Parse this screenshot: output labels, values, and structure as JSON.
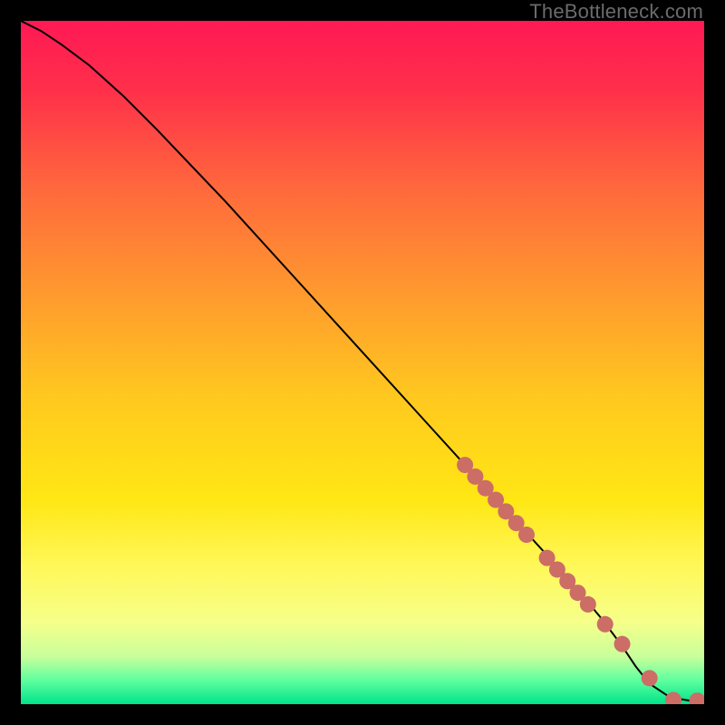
{
  "watermark": "TheBottleneck.com",
  "chart_data": {
    "type": "line",
    "title": "",
    "xlabel": "",
    "ylabel": "",
    "xlim": [
      0,
      100
    ],
    "ylim": [
      0,
      100
    ],
    "grid": false,
    "legend": false,
    "series": [
      {
        "name": "curve",
        "type": "line",
        "color": "#000000",
        "x": [
          0,
          3,
          6,
          10,
          15,
          20,
          30,
          40,
          50,
          60,
          70,
          80,
          85,
          88,
          90,
          92,
          95,
          98,
          100
        ],
        "y": [
          100,
          98.5,
          96.5,
          93.5,
          89,
          84,
          73.5,
          62.5,
          51.5,
          40.5,
          29.5,
          18.5,
          12.5,
          8.5,
          5.5,
          3,
          1,
          0.5,
          0.5
        ]
      },
      {
        "name": "dotted-segment",
        "type": "scatter",
        "color": "#cc6d66",
        "marker_radius": 9,
        "x": [
          65.0,
          66.5,
          68.0,
          69.5,
          71.0,
          72.5,
          74.0,
          77.0,
          78.5,
          80.0,
          81.5,
          83.0,
          85.5,
          88.0,
          92.0,
          95.5,
          99.0
        ],
        "y": [
          35.0,
          33.3,
          31.6,
          29.9,
          28.2,
          26.5,
          24.8,
          21.4,
          19.7,
          18.0,
          16.3,
          14.6,
          11.7,
          8.8,
          3.8,
          0.6,
          0.5
        ]
      }
    ],
    "background_gradient": {
      "type": "vertical",
      "stops": [
        {
          "pos": 0.0,
          "color": "#ff1955"
        },
        {
          "pos": 0.1,
          "color": "#ff2f4a"
        },
        {
          "pos": 0.25,
          "color": "#ff6a3c"
        },
        {
          "pos": 0.4,
          "color": "#ff9a2e"
        },
        {
          "pos": 0.55,
          "color": "#ffc81f"
        },
        {
          "pos": 0.7,
          "color": "#ffe714"
        },
        {
          "pos": 0.8,
          "color": "#fff85a"
        },
        {
          "pos": 0.88,
          "color": "#f6ff8a"
        },
        {
          "pos": 0.93,
          "color": "#c9ff9a"
        },
        {
          "pos": 0.965,
          "color": "#5fff9f"
        },
        {
          "pos": 1.0,
          "color": "#00e38a"
        }
      ]
    }
  }
}
